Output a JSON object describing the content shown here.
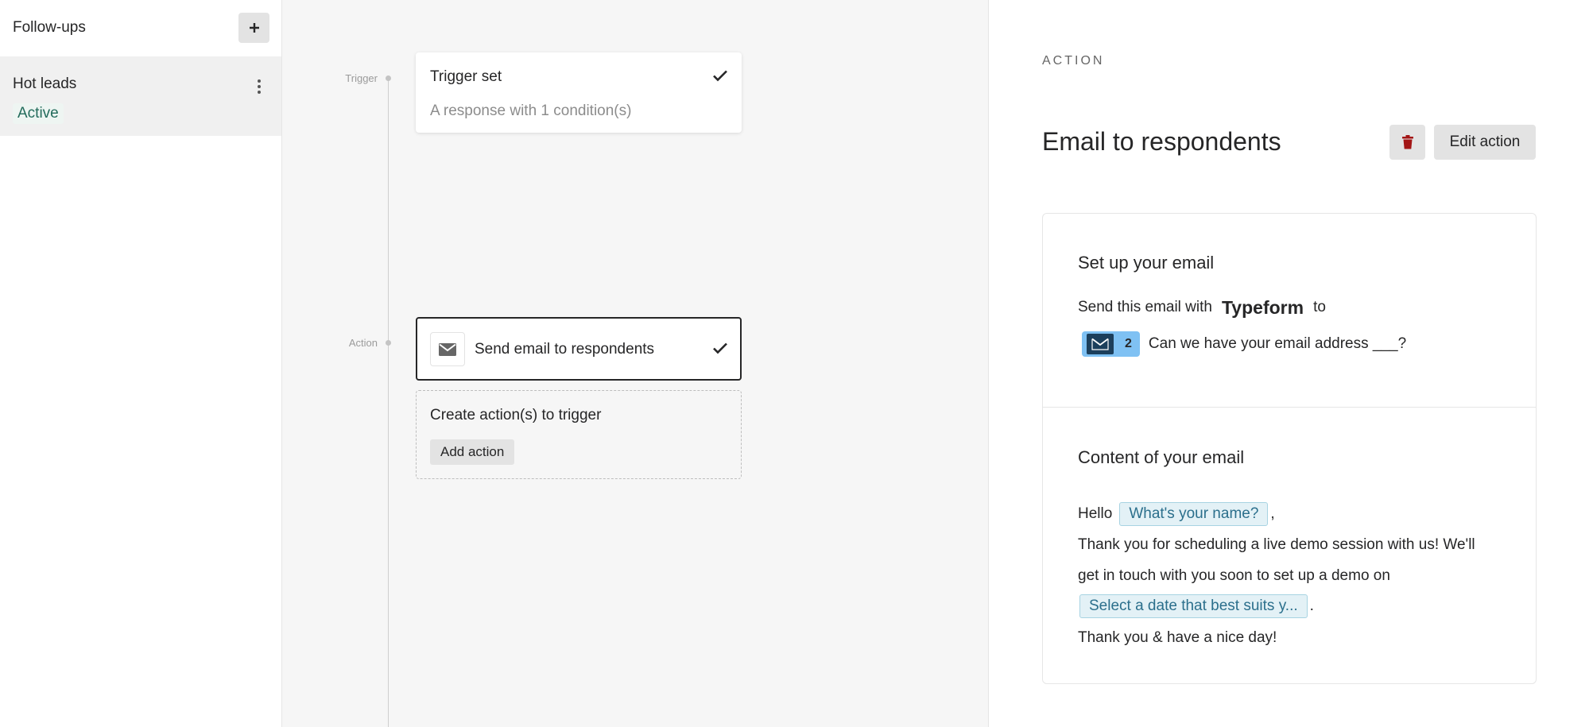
{
  "sidebar": {
    "title": "Follow-ups",
    "add_icon": "plus-icon",
    "flows": [
      {
        "name": "Hot leads",
        "status": "Active"
      }
    ]
  },
  "canvas": {
    "timeline": {
      "trigger_label": "Trigger",
      "action_label": "Action"
    },
    "trigger_card": {
      "title": "Trigger set",
      "subtitle": "A response with 1 condition(s)"
    },
    "action_card": {
      "title": "Send email to respondents",
      "icon": "mail-icon"
    },
    "create_card": {
      "title": "Create action(s) to trigger",
      "button_label": "Add action"
    }
  },
  "panel": {
    "section_label": "ACTION",
    "title": "Email to respondents",
    "delete_icon": "trash-icon",
    "edit_label": "Edit action",
    "setup": {
      "title": "Set up your email",
      "send_prefix": "Send this email with",
      "brand": "Typeform",
      "send_suffix": "to",
      "question_number": "2",
      "question_text": "Can we have your email address ___?"
    },
    "content": {
      "title": "Content of your email",
      "greeting": "Hello",
      "name_pill": "What's your name?",
      "comma": ",",
      "line1": "Thank you for scheduling a live demo session with us! We'll",
      "line2": "get in touch with you soon to set up a demo on",
      "date_pill": "Select a date that best suits y...",
      "period": ".",
      "closing": "Thank you & have a nice day!"
    }
  },
  "colors": {
    "active_status": "#226b5b",
    "delete_icon": "#a31515",
    "question_badge": "#7fc1f3",
    "pill_text": "#2b6f8c"
  }
}
